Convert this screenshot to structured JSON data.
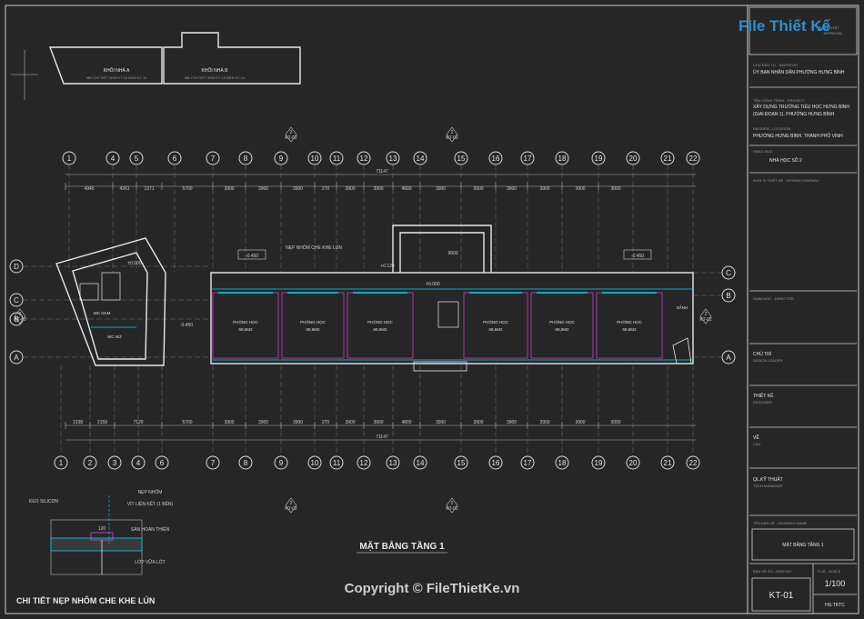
{
  "watermark": {
    "logo_text": "File Thiết Kế",
    "logo_suffix": ".vn",
    "copyright": "Copyright © FileThietKe.vn"
  },
  "key_plan": {
    "block_a": "KHỐI NHÀ A",
    "block_a_note": "MB CHI TIẾT XEM KT-04 ĐẾN KT-11",
    "block_b": "KHỐI NHÀ B",
    "block_b_note": "MB CHI TIẾT XEM KT-12 ĐẾN KT-14"
  },
  "axes_top": [
    "1",
    "4",
    "5",
    "6",
    "7",
    "8",
    "9",
    "10",
    "11",
    "12",
    "13",
    "14",
    "15",
    "16",
    "17",
    "18",
    "19",
    "20",
    "21",
    "22"
  ],
  "axes_bottom": [
    "1",
    "2",
    "3",
    "4",
    "6",
    "7",
    "8",
    "9",
    "10",
    "11",
    "12",
    "13",
    "14",
    "15",
    "16",
    "17",
    "18",
    "19",
    "20",
    "21",
    "22"
  ],
  "axes_left": [
    "D",
    "C",
    "B",
    "A"
  ],
  "axes_right": [
    "C",
    "B",
    "A"
  ],
  "dims": {
    "total": "71147",
    "top_row": [
      "4945",
      "4261",
      "1371",
      "5700",
      "3900",
      "3900",
      "3900",
      "270",
      "3900",
      "3900",
      "4800",
      "3900",
      "3900",
      "3900",
      "3900",
      "3900",
      "3000"
    ],
    "bottom_row": [
      "1238",
      "2159",
      "7120",
      "5700",
      "3900",
      "3900",
      "3900",
      "270",
      "3900",
      "3900",
      "4800",
      "3900",
      "3900",
      "3900",
      "3900",
      "3900",
      "3000"
    ],
    "misc": [
      "9600",
      "600",
      "600",
      "9920",
      "6450",
      "5200",
      "3370",
      "2570",
      "4520",
      "3150",
      "2060",
      "1000",
      "8067",
      "2704",
      "3000",
      "1650",
      "2428",
      "9530"
    ]
  },
  "levels": [
    "-0.450",
    "-0.450",
    "±0.000",
    "±0.000",
    "+0.120",
    "-0.450",
    "±0.000"
  ],
  "labels": {
    "joint_note": "NẸP NHÔM CHE KHE LÚN",
    "wc_male": "WC NAM",
    "wc_female": "WC NỮ",
    "classroom": "PHÒNG HỌC",
    "classroom_area": "68,6M2",
    "ramp": "DỐC",
    "sanh": "SẢNH"
  },
  "plan_title": "MẶT BẰNG TẦNG 1",
  "detail": {
    "title": "CHI TIẾT NẸP NHÔM CHE KHE LÚN",
    "dim": "120",
    "notes": [
      "KEO SILICON",
      "NẸP NHÔM",
      "VÍT LIÊN KẾT (1 BÊN)",
      "SÀN HOÀN THIỆN",
      "LỚP VỮA LÓT"
    ]
  },
  "section_marks": [
    "2",
    "KT-02"
  ],
  "title_block": {
    "status": "DUYỆT",
    "status_sub": "APPROVAL",
    "owner_label": "CHỦ ĐẦU TƯ - INVESTOR",
    "owner": "ỦY BAN NHÂN DÂN PHƯỜNG HƯNG BÌNH",
    "project_label": "TÊN CÔNG TRÌNH - PROJECT",
    "project": "XÂY DỰNG TRƯỜNG TIỂU HỌC HƯNG BÌNH",
    "project_2": "(GIAI ĐOẠN 1), PHƯỜNG HƯNG BÌNH",
    "location_label": "ĐỊA ĐIỂM - LOCATION",
    "location": "PHƯỜNG HƯNG BÌNH, THÀNH PHỐ VINH",
    "item_label": "HẠNG MỤC",
    "item": "NHÀ HỌC SỐ 2",
    "designer_label": "ĐƠN VỊ THIẾT KẾ - DESIGN COMPANY",
    "director_label": "GIÁM ĐỐC - DIRECTOR",
    "leader_label": "CHỦ TRÌ",
    "leader_sub": "DESIGN LEADER",
    "design_label": "THIẾT KẾ",
    "design_sub": "DESIGNER",
    "draw_label": "VẼ",
    "draw_sub": "CAD",
    "tech_label": "QL.KỸ THUẬT",
    "tech_sub": "TECH MANAGER",
    "name_label": "TÊN BẢN VẼ - DRAWING NAME",
    "name": "MẶT BẰNG TẦNG 1",
    "no_label": "BẢN VẼ SỐ - DWG NO",
    "no": "KT-01",
    "scale_label": "TỈ LỆ - SCALE",
    "scale": "1/100",
    "phase": "HS-TKTC"
  },
  "colors": {
    "background": "#262626",
    "lines": "#e8e8e8",
    "accent_cyan": "#00d8ff",
    "accent_magenta": "#e040e0",
    "watermark_blue": "#2a8fd0"
  }
}
